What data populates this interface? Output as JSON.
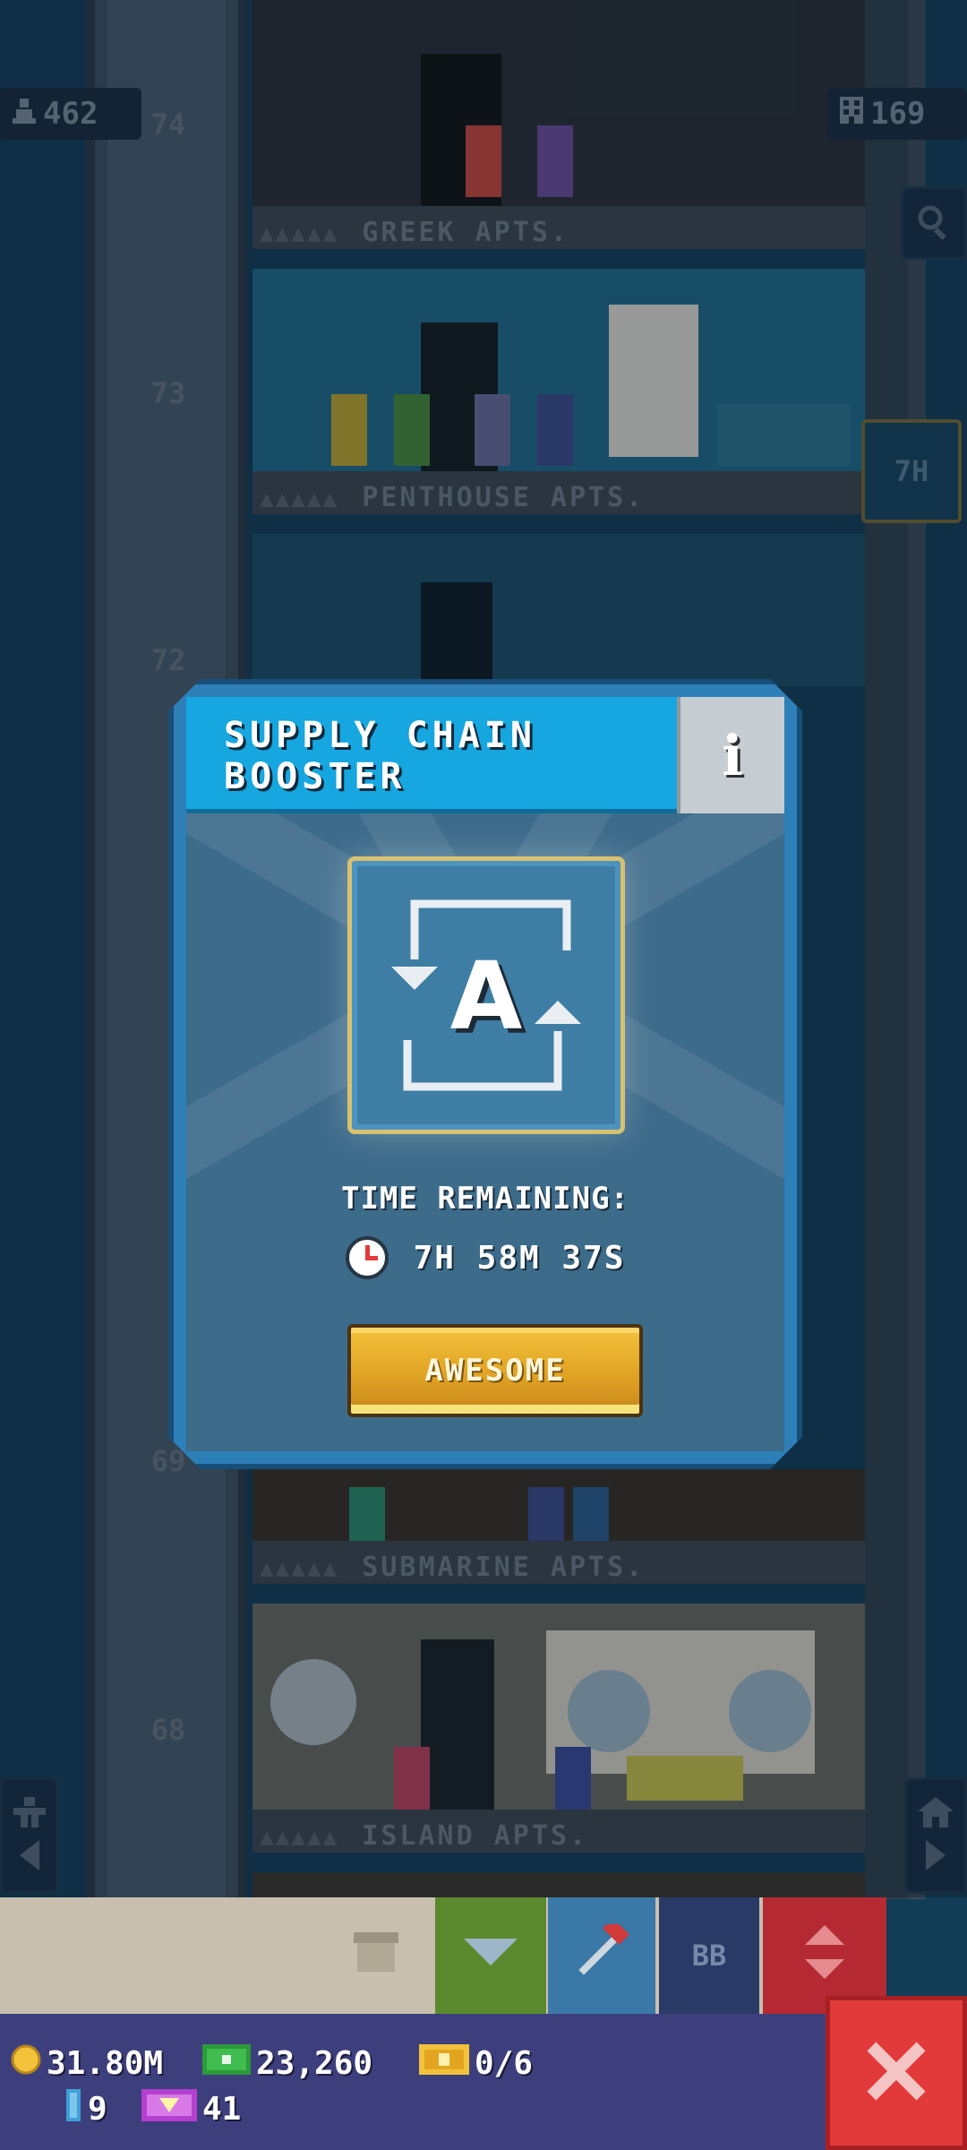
{
  "hud": {
    "population": "462",
    "floors": "169",
    "timer_chip": "7H"
  },
  "tower": {
    "floor_labels": [
      {
        "dots": "▲▲▲▲▲",
        "name": "GREEK APTS."
      },
      {
        "dots": "▲▲▲▲▲",
        "name": "PENTHOUSE APTS."
      },
      {
        "dots": "▲▲▲▲▲",
        "name": "SUBMARINE APTS."
      },
      {
        "dots": "▲▲▲▲▲",
        "name": "ISLAND APTS."
      }
    ],
    "floor_numbers": [
      "74",
      "73",
      "72",
      "69",
      "68"
    ]
  },
  "dialog": {
    "title": "SUPPLY CHAIN BOOSTER",
    "info_label": "i",
    "time_label": "TIME REMAINING:",
    "time_value": "7H 58M 37S",
    "button_label": "AWESOME",
    "booster_letter": "A"
  },
  "toolbar": {
    "bb_label": "BB"
  },
  "status": {
    "coins": "31.80M",
    "bux": "23,260",
    "tickets": "0/6",
    "keys": "9",
    "vip": "41"
  },
  "colors": {
    "title_bar": "#16a6e0",
    "dialog_frame": "#2d7fb8",
    "button_gold": "#e0a323",
    "close_red": "#e23a3a",
    "status_bar": "#3d3f7d"
  },
  "icons": [
    "population-icon",
    "floors-icon",
    "search-icon",
    "clock-icon",
    "swap-arrows-icon",
    "close-icon",
    "coin-icon",
    "bux-icon",
    "ticket-icon",
    "key-icon",
    "vip-icon",
    "elevator-icon",
    "hammer-icon",
    "box-icon",
    "person-icon",
    "home-icon"
  ]
}
